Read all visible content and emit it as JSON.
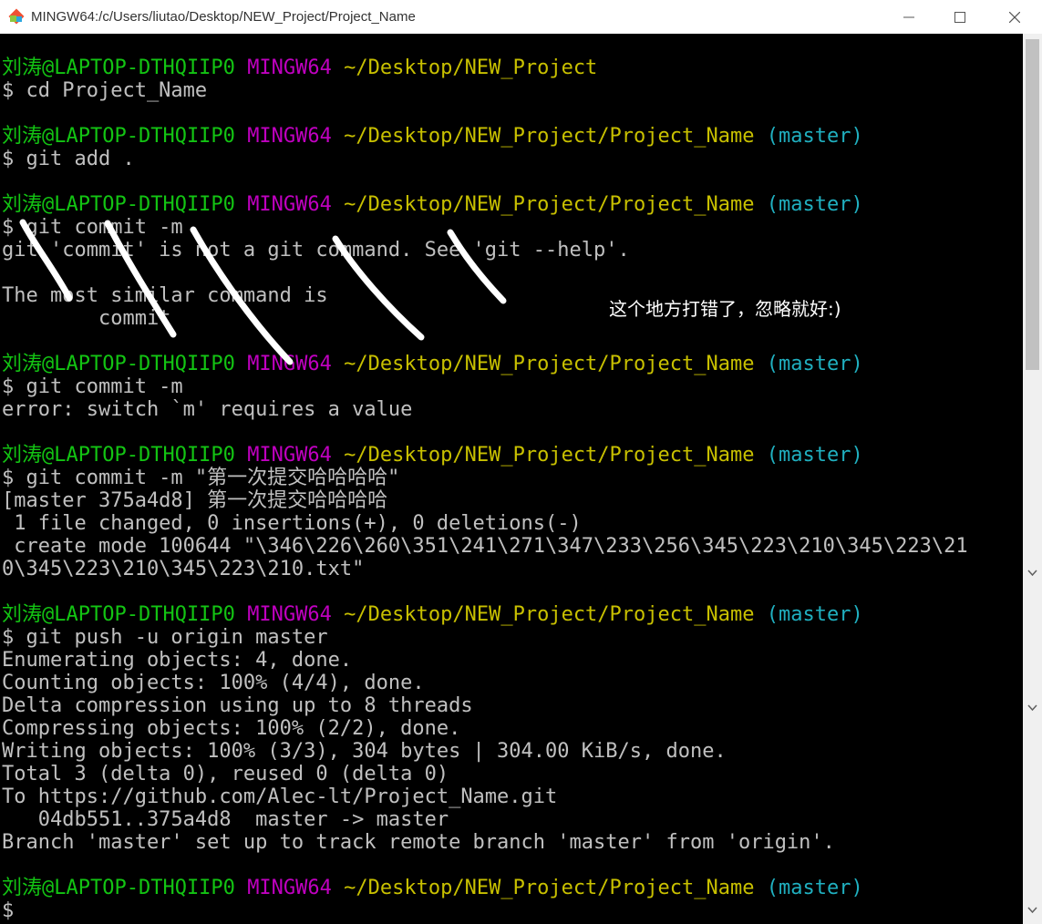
{
  "window": {
    "title": "MINGW64:/c/Users/liutao/Desktop/NEW_Project/Project_Name"
  },
  "prompt": {
    "user": "刘涛@LAPTOP-DTHQIIP0",
    "host": "MINGW64",
    "path_parent": "~/Desktop/NEW_Project",
    "path_project": "~/Desktop/NEW_Project/Project_Name",
    "branch": "(master)"
  },
  "terminal": {
    "cmd_cd": "$ cd Project_Name",
    "cmd_add": "$ git add .",
    "cmd_commit_bad": "$ git commit -m",
    "err_not_cmd": "git 'commit' is not a git command. See 'git --help'.",
    "similar_hdr": "The most similar command is",
    "similar_cmd": "        commit",
    "cmd_commit_m": "$ git commit -m",
    "err_switch": "error: switch `m' requires a value",
    "cmd_commit_msg": "$ git commit -m \"第一次提交哈哈哈哈\"",
    "commit_result": "[master 375a4d8] 第一次提交哈哈哈哈",
    "files_changed": " 1 file changed, 0 insertions(+), 0 deletions(-)",
    "create_mode_1": " create mode 100644 \"\\346\\226\\260\\351\\241\\271\\347\\233\\256\\345\\223\\210\\345\\223\\21",
    "create_mode_2": "0\\345\\223\\210\\345\\223\\210.txt\"",
    "cmd_push": "$ git push -u origin master",
    "push_1": "Enumerating objects: 4, done.",
    "push_2": "Counting objects: 100% (4/4), done.",
    "push_3": "Delta compression using up to 8 threads",
    "push_4": "Compressing objects: 100% (2/2), done.",
    "push_5": "Writing objects: 100% (3/3), 304 bytes | 304.00 KiB/s, done.",
    "push_6": "Total 3 (delta 0), reused 0 (delta 0)",
    "push_7": "To https://github.com/Alec-lt/Project_Name.git",
    "push_8": "   04db551..375a4d8  master -> master",
    "push_9": "Branch 'master' set up to track remote branch 'master' from 'origin'.",
    "cursor_line": "$"
  },
  "annotation": {
    "note": "这个地方打错了，忽略就好:)"
  },
  "colors": {
    "user": "#13c413",
    "host": "#c000c0",
    "path": "#c8c000",
    "branch": "#20b0c0",
    "output": "#c0c0c0",
    "background": "#000000"
  },
  "icons": [
    "git-bash-icon",
    "minimize-icon",
    "maximize-icon",
    "close-icon",
    "scroll-up-icon",
    "scroll-down-icon"
  ]
}
